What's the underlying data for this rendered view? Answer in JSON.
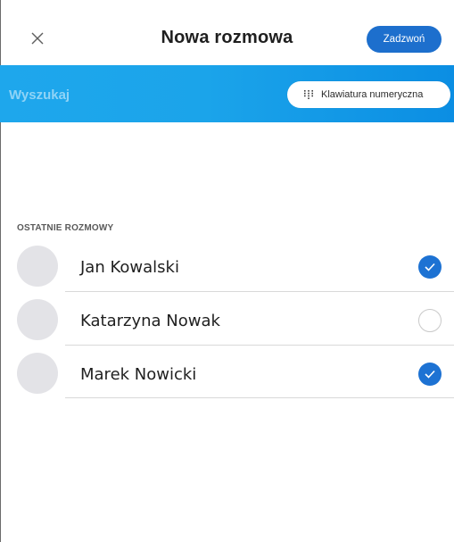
{
  "header": {
    "title": "Nowa rozmowa",
    "call_label": "Zadzwoń"
  },
  "search": {
    "placeholder": "Wyszukaj",
    "keypad_label": "Klawiatura numeryczna"
  },
  "recent": {
    "section_title": "OSTATNIE ROZMOWY",
    "contacts": [
      {
        "name": "Jan Kowalski",
        "selected": true
      },
      {
        "name": "Katarzyna Nowak",
        "selected": false
      },
      {
        "name": "Marek Nowicki",
        "selected": true
      }
    ]
  },
  "colors": {
    "accent": "#1d6fcd",
    "search_bar_start": "#1ea7ec",
    "search_bar_end": "#0b8ee3",
    "avatar": "#e3e3e7"
  },
  "icons": {
    "close": "close-icon",
    "keypad": "dialpad-icon",
    "check": "checkmark-icon"
  }
}
